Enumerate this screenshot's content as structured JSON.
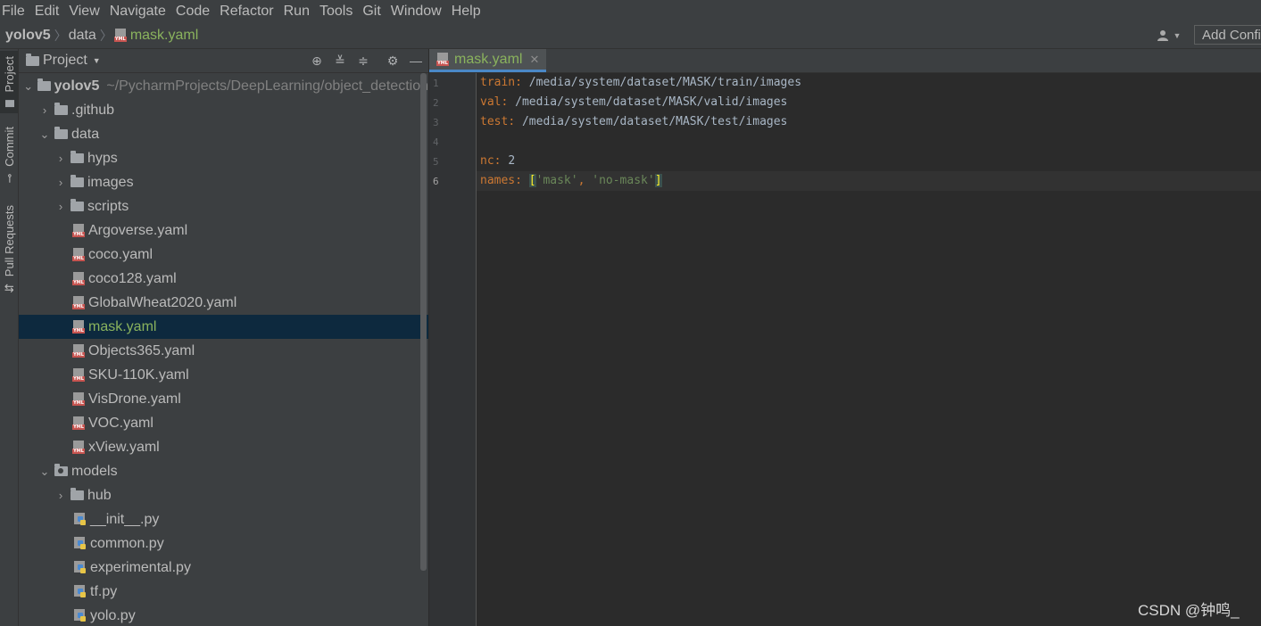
{
  "menu": [
    "File",
    "Edit",
    "View",
    "Navigate",
    "Code",
    "Refactor",
    "Run",
    "Tools",
    "Git",
    "Window",
    "Help"
  ],
  "breadcrumb": {
    "project": "yolov5",
    "folder": "data",
    "file": "mask.yaml"
  },
  "toolbar": {
    "add_config": "Add Configuration..."
  },
  "left_stripe": {
    "project": "Project",
    "commit": "Commit",
    "pull_requests": "Pull Requests"
  },
  "project_panel": {
    "title": "Project",
    "root_name": "yolov5",
    "root_path": "~/PycharmProjects/DeepLearning/object_detection",
    "items": {
      "github": ".github",
      "data": "data",
      "hyps": "hyps",
      "images": "images",
      "scripts": "scripts",
      "argoverse": "Argoverse.yaml",
      "coco": "coco.yaml",
      "coco128": "coco128.yaml",
      "globalwheat": "GlobalWheat2020.yaml",
      "mask": "mask.yaml",
      "objects365": "Objects365.yaml",
      "sku": "SKU-110K.yaml",
      "visdrone": "VisDrone.yaml",
      "voc": "VOC.yaml",
      "xview": "xView.yaml",
      "models": "models",
      "hub": "hub",
      "init": "__init__.py",
      "common": "common.py",
      "experimental": "experimental.py",
      "tf": "tf.py",
      "yolo": "yolo.py"
    }
  },
  "editor": {
    "tab_label": "mask.yaml",
    "line_numbers": [
      "1",
      "2",
      "3",
      "4",
      "5",
      "6"
    ],
    "lines": {
      "l1_key": "train",
      "l1_val": " /media/system/dataset/MASK/train/images",
      "l2_key": "val",
      "l2_val": " /media/system/dataset/MASK/valid/images",
      "l3_key": "test",
      "l3_val": " /media/system/dataset/MASK/test/images",
      "l5_key": "nc",
      "l5_val": "2",
      "l6_key": "names",
      "l6_item1": "'mask'",
      "l6_item2": "'no-mask'"
    }
  },
  "watermark": "CSDN @钟鸣_"
}
